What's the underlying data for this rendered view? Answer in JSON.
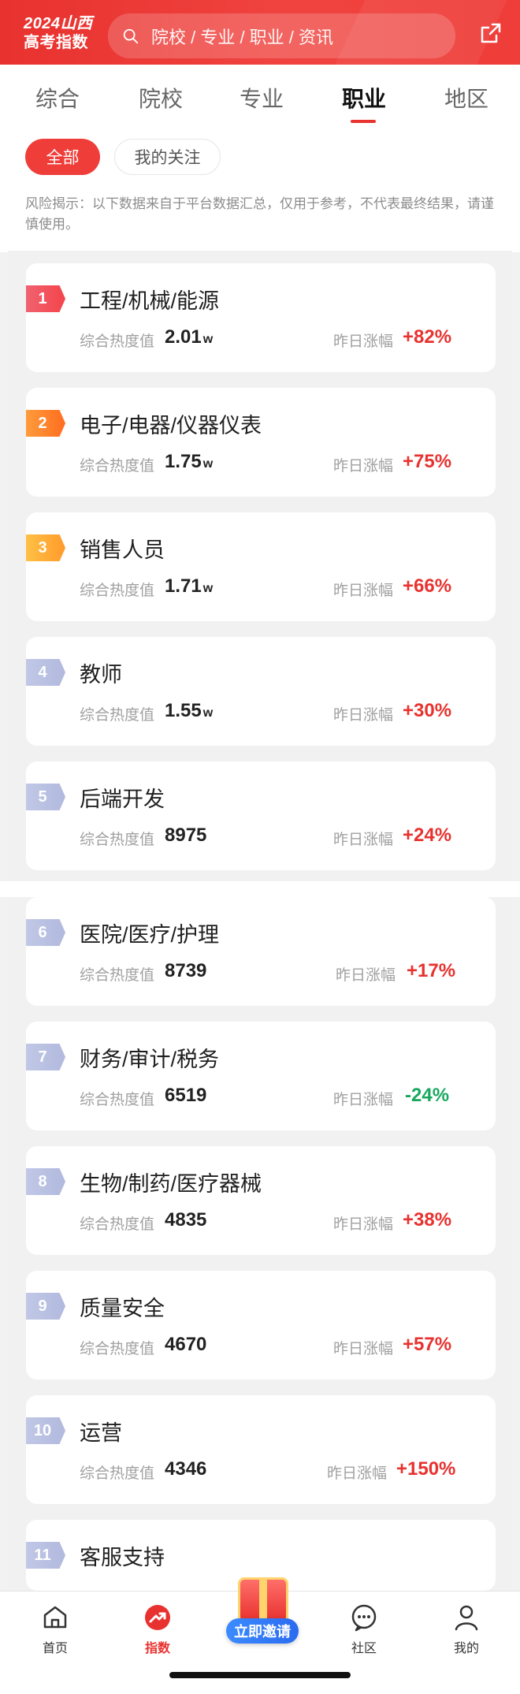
{
  "header": {
    "brand_line1": "2024山西",
    "brand_line2": "高考指数",
    "search_placeholder": "院校 / 专业 / 职业 / 资讯"
  },
  "tabs": [
    "综合",
    "院校",
    "专业",
    "职业",
    "地区"
  ],
  "active_tab": "职业",
  "filters": {
    "all": "全部",
    "follow": "我的关注"
  },
  "risk_notice": "风险揭示：以下数据来自于平台数据汇总，仅用于参考，不代表最终结果，请谨慎使用。",
  "labels": {
    "heat": "综合热度值",
    "yesterday_change": "昨日涨幅"
  },
  "list": [
    {
      "rank": "1",
      "name": "工程/机械/能源",
      "heat": "2.01",
      "unit": "w",
      "change": "+82%",
      "trend": "up"
    },
    {
      "rank": "2",
      "name": "电子/电器/仪器仪表",
      "heat": "1.75",
      "unit": "w",
      "change": "+75%",
      "trend": "up"
    },
    {
      "rank": "3",
      "name": "销售人员",
      "heat": "1.71",
      "unit": "w",
      "change": "+66%",
      "trend": "up"
    },
    {
      "rank": "4",
      "name": "教师",
      "heat": "1.55",
      "unit": "w",
      "change": "+30%",
      "trend": "up"
    },
    {
      "rank": "5",
      "name": "后端开发",
      "heat": "8975",
      "unit": "",
      "change": "+24%",
      "trend": "up"
    },
    {
      "rank": "6",
      "name": "医院/医疗/护理",
      "heat": "8739",
      "unit": "",
      "change": "+17%",
      "trend": "up"
    },
    {
      "rank": "7",
      "name": "财务/审计/税务",
      "heat": "6519",
      "unit": "",
      "change": "-24%",
      "trend": "down"
    },
    {
      "rank": "8",
      "name": "生物/制药/医疗器械",
      "heat": "4835",
      "unit": "",
      "change": "+38%",
      "trend": "up"
    },
    {
      "rank": "9",
      "name": "质量安全",
      "heat": "4670",
      "unit": "",
      "change": "+57%",
      "trend": "up"
    },
    {
      "rank": "10",
      "name": "运营",
      "heat": "4346",
      "unit": "",
      "change": "+150%",
      "trend": "up"
    },
    {
      "rank": "11",
      "name": "客服支持",
      "heat": "",
      "unit": "",
      "change": "",
      "trend": "up"
    }
  ],
  "bottom_nav": {
    "home": "首页",
    "index": "指数",
    "invite": "立即邀请",
    "community": "社区",
    "mine": "我的"
  },
  "colors": {
    "brand_red": "#e8322f",
    "down_green": "#16a85e"
  }
}
